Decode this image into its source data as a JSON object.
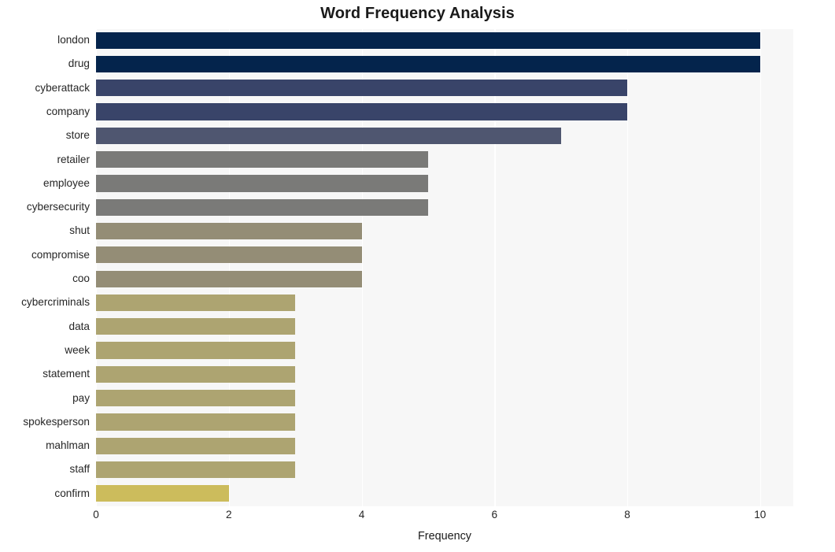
{
  "chart_data": {
    "type": "bar",
    "orientation": "horizontal",
    "title": "Word Frequency Analysis",
    "xlabel": "Frequency",
    "ylabel": "",
    "xlim": [
      0,
      10.5
    ],
    "xticks": [
      0,
      2,
      4,
      6,
      8,
      10
    ],
    "xtick_labels": [
      "0",
      "2",
      "4",
      "6",
      "8",
      "10"
    ],
    "grid": true,
    "grid_axis": "x",
    "grid_color": "#ffffff",
    "plot_background": "#f7f7f7",
    "figure_background": "#ffffff",
    "legend": null,
    "categories": [
      "london",
      "drug",
      "cyberattack",
      "company",
      "store",
      "retailer",
      "employee",
      "cybersecurity",
      "shut",
      "compromise",
      "coo",
      "cybercriminals",
      "data",
      "week",
      "statement",
      "pay",
      "spokesperson",
      "mahlman",
      "staff",
      "confirm"
    ],
    "values": [
      10,
      10,
      8,
      8,
      7,
      5,
      5,
      5,
      4,
      4,
      4,
      3,
      3,
      3,
      3,
      3,
      3,
      3,
      3,
      2
    ],
    "bar_colors": [
      "#04244c",
      "#04244c",
      "#394469",
      "#394469",
      "#4f5670",
      "#7a7a78",
      "#7a7a78",
      "#7a7a78",
      "#948d76",
      "#948d76",
      "#948d76",
      "#ada471",
      "#ada471",
      "#ada471",
      "#ada471",
      "#ada471",
      "#ada471",
      "#ada471",
      "#ada471",
      "#ccbc5c"
    ]
  }
}
